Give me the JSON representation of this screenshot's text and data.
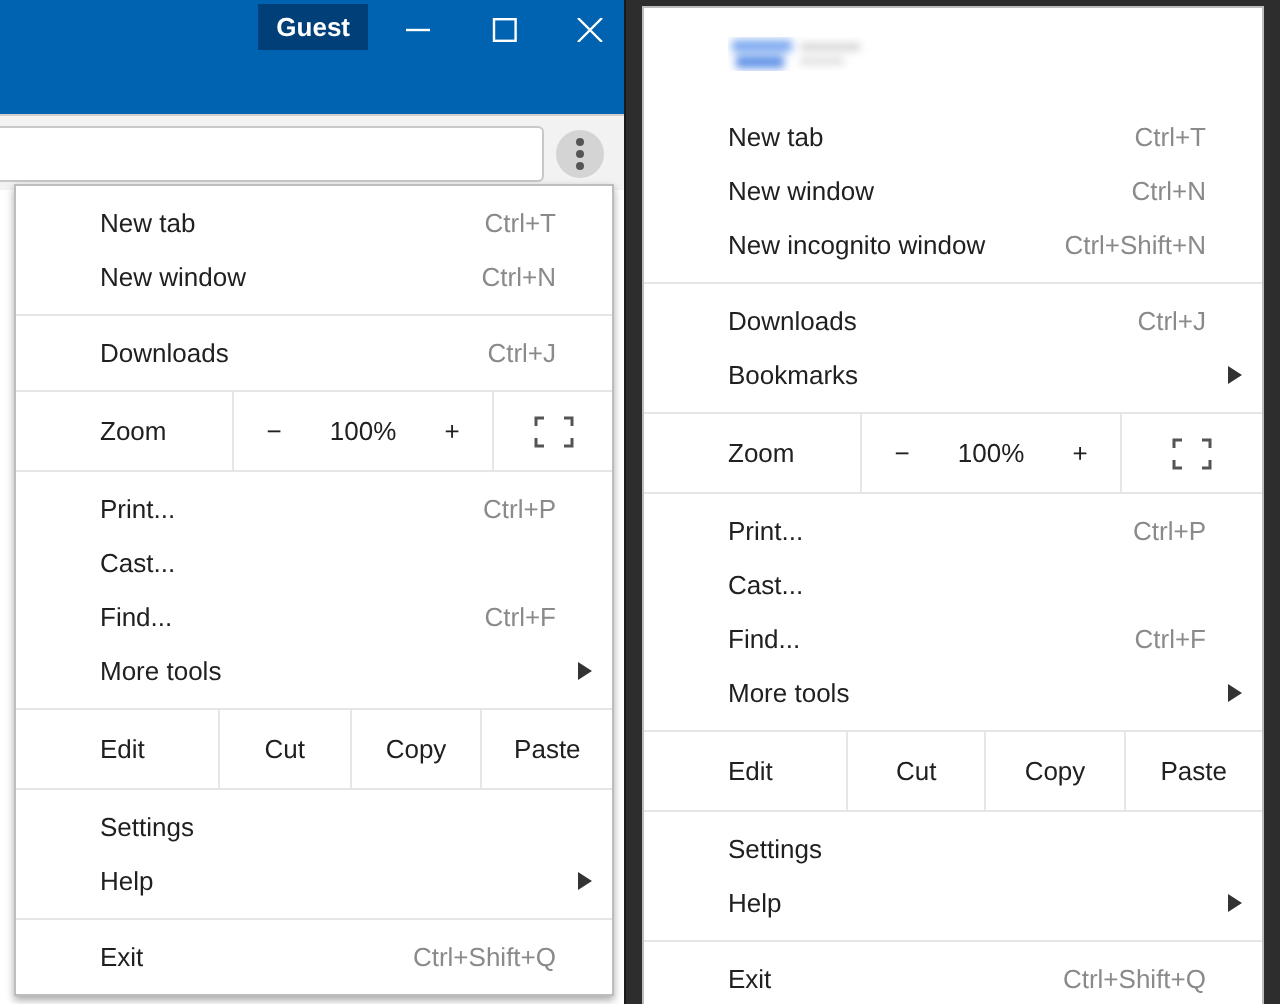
{
  "browser_window": {
    "guest_badge": "Guest",
    "menu": {
      "sections": [
        {
          "rows": [
            {
              "kind": "item",
              "label": "New tab",
              "shortcut": "Ctrl+T",
              "has_submenu": false
            },
            {
              "kind": "item",
              "label": "New window",
              "shortcut": "Ctrl+N",
              "has_submenu": false
            }
          ]
        },
        {
          "rows": [
            {
              "kind": "item",
              "label": "Downloads",
              "shortcut": "Ctrl+J",
              "has_submenu": false
            }
          ]
        },
        {
          "rows": [
            {
              "kind": "zoom",
              "label": "Zoom",
              "minus": "−",
              "value": "100%",
              "plus": "+"
            }
          ]
        },
        {
          "rows": [
            {
              "kind": "item",
              "label": "Print...",
              "shortcut": "Ctrl+P",
              "has_submenu": false
            },
            {
              "kind": "item",
              "label": "Cast...",
              "has_submenu": false
            },
            {
              "kind": "item",
              "label": "Find...",
              "shortcut": "Ctrl+F",
              "has_submenu": false
            },
            {
              "kind": "item",
              "label": "More tools",
              "has_submenu": true
            }
          ]
        },
        {
          "rows": [
            {
              "kind": "edit",
              "label": "Edit",
              "buttons": [
                "Cut",
                "Copy",
                "Paste"
              ]
            }
          ]
        },
        {
          "rows": [
            {
              "kind": "item",
              "label": "Settings",
              "has_submenu": false
            },
            {
              "kind": "item",
              "label": "Help",
              "has_submenu": true
            }
          ]
        },
        {
          "rows": [
            {
              "kind": "item",
              "label": "Exit",
              "shortcut": "Ctrl+Shift+Q",
              "has_submenu": false
            }
          ]
        }
      ]
    }
  },
  "second_menu": {
    "sections": [
      {
        "rows": [
          {
            "kind": "item",
            "label": "New tab",
            "shortcut": "Ctrl+T",
            "has_submenu": false
          },
          {
            "kind": "item",
            "label": "New window",
            "shortcut": "Ctrl+N",
            "has_submenu": false
          },
          {
            "kind": "item",
            "label": "New incognito window",
            "shortcut": "Ctrl+Shift+N",
            "has_submenu": false
          }
        ]
      },
      {
        "rows": [
          {
            "kind": "item",
            "label": "Downloads",
            "shortcut": "Ctrl+J",
            "has_submenu": false
          },
          {
            "kind": "item",
            "label": "Bookmarks",
            "has_submenu": true
          }
        ]
      },
      {
        "rows": [
          {
            "kind": "zoom",
            "label": "Zoom",
            "minus": "−",
            "value": "100%",
            "plus": "+"
          }
        ]
      },
      {
        "rows": [
          {
            "kind": "item",
            "label": "Print...",
            "shortcut": "Ctrl+P",
            "has_submenu": false
          },
          {
            "kind": "item",
            "label": "Cast...",
            "has_submenu": false
          },
          {
            "kind": "item",
            "label": "Find...",
            "shortcut": "Ctrl+F",
            "has_submenu": false
          },
          {
            "kind": "item",
            "label": "More tools",
            "has_submenu": true
          }
        ]
      },
      {
        "rows": [
          {
            "kind": "edit",
            "label": "Edit",
            "buttons": [
              "Cut",
              "Copy",
              "Paste"
            ]
          }
        ]
      },
      {
        "rows": [
          {
            "kind": "item",
            "label": "Settings",
            "has_submenu": false
          },
          {
            "kind": "item",
            "label": "Help",
            "has_submenu": true
          }
        ]
      },
      {
        "rows": [
          {
            "kind": "item",
            "label": "Exit",
            "shortcut": "Ctrl+Shift+Q",
            "has_submenu": false
          }
        ]
      }
    ]
  }
}
